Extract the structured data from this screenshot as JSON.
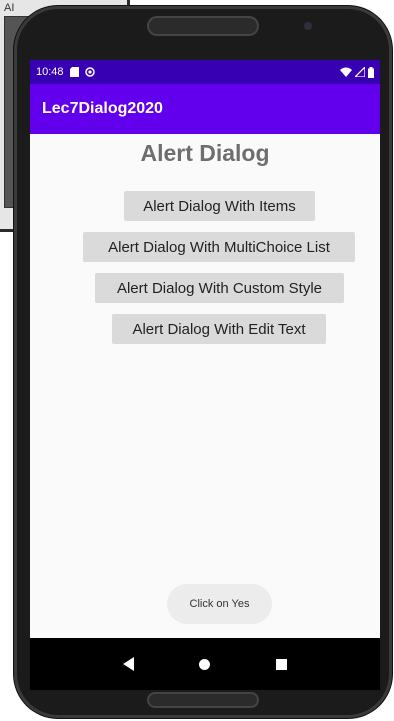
{
  "background_window": {
    "text": "AI"
  },
  "status_bar": {
    "time": "10:48",
    "left_icons": [
      "sd-card-icon",
      "at-sign-icon"
    ],
    "right_icons": [
      "wifi-icon",
      "signal-icon",
      "battery-icon"
    ]
  },
  "app_bar": {
    "title": "Lec7Dialog2020"
  },
  "main": {
    "title": "Alert Dialog",
    "buttons": [
      {
        "label": "Alert Dialog With Items"
      },
      {
        "label": "Alert Dialog With MultiChoice List"
      },
      {
        "label": "Alert Dialog With Custom Style"
      },
      {
        "label": "Alert Dialog With Edit Text"
      }
    ]
  },
  "toast": {
    "text": "Click on Yes"
  },
  "nav_bar": {
    "icons": [
      "back-icon",
      "home-icon",
      "recent-apps-icon"
    ]
  },
  "colors": {
    "status_bar": "#3700b3",
    "app_bar": "#6200ee",
    "button_bg": "#dadada",
    "screen_bg": "#fafafa"
  }
}
